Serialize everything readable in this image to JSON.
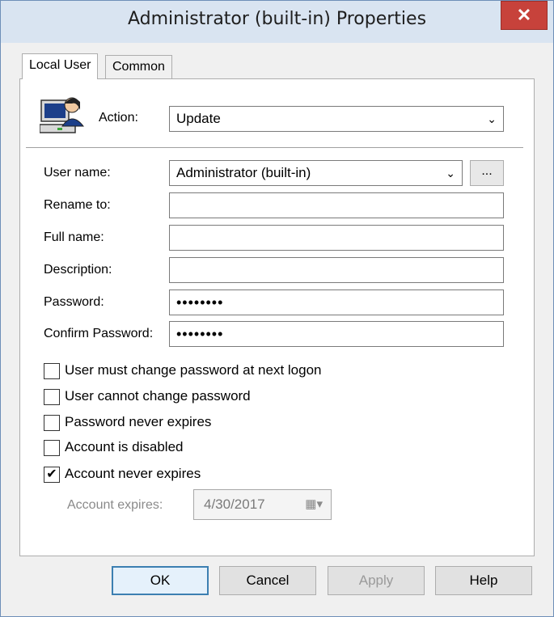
{
  "window": {
    "title": "Administrator (built-in) Properties",
    "close_label": "✕"
  },
  "tabs": [
    {
      "label": "Local User",
      "active": true
    },
    {
      "label": "Common",
      "active": false
    }
  ],
  "action": {
    "label": "Action:",
    "value": "Update"
  },
  "fields": {
    "username": {
      "label": "User name:",
      "value": "Administrator (built-in)"
    },
    "rename": {
      "label": "Rename to:",
      "value": ""
    },
    "fullname": {
      "label": "Full name:",
      "value": ""
    },
    "description": {
      "label": "Description:",
      "value": ""
    },
    "password": {
      "label": "Password:",
      "value": "••••••••"
    },
    "confirm": {
      "label": "Confirm Password:",
      "value": "••••••••"
    }
  },
  "browse_label": "...",
  "checkboxes": [
    {
      "label": "User must change password at next logon",
      "checked": false
    },
    {
      "label": "User cannot change password",
      "checked": false
    },
    {
      "label": "Password never expires",
      "checked": false
    },
    {
      "label": "Account is disabled",
      "checked": false
    },
    {
      "label": "Account never expires",
      "checked": true
    }
  ],
  "expires": {
    "label": "Account expires:",
    "value": "4/30/2017"
  },
  "buttons": {
    "ok": "OK",
    "cancel": "Cancel",
    "apply": "Apply",
    "help": "Help"
  },
  "colors": {
    "accent": "#3c7fb1",
    "titlebar": "#d9e4f1",
    "close": "#c7423b"
  }
}
